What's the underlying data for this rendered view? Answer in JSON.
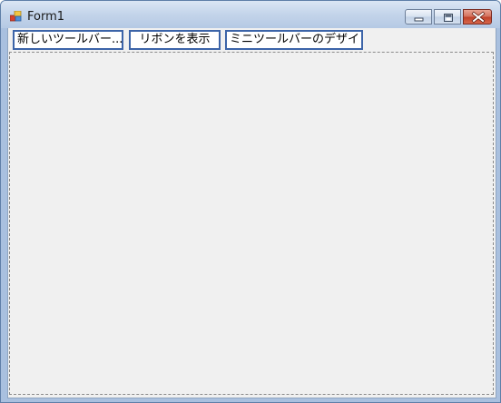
{
  "window": {
    "title": "Form1",
    "app_icon": "form-app-icon",
    "controls": {
      "minimize_icon": "minimize-icon",
      "maximize_icon": "maximize-icon",
      "close_icon": "close-icon"
    }
  },
  "toolbar": {
    "buttons": [
      {
        "label": "新しいツールバー..."
      },
      {
        "label": "リボンを表示"
      },
      {
        "label": "ミニツールバーのデザイン"
      }
    ]
  },
  "colors": {
    "title_bar": "#c3d4ea",
    "close_button": "#c0432b",
    "button_border": "#3c64a8",
    "client_background": "#f0f0f0"
  }
}
